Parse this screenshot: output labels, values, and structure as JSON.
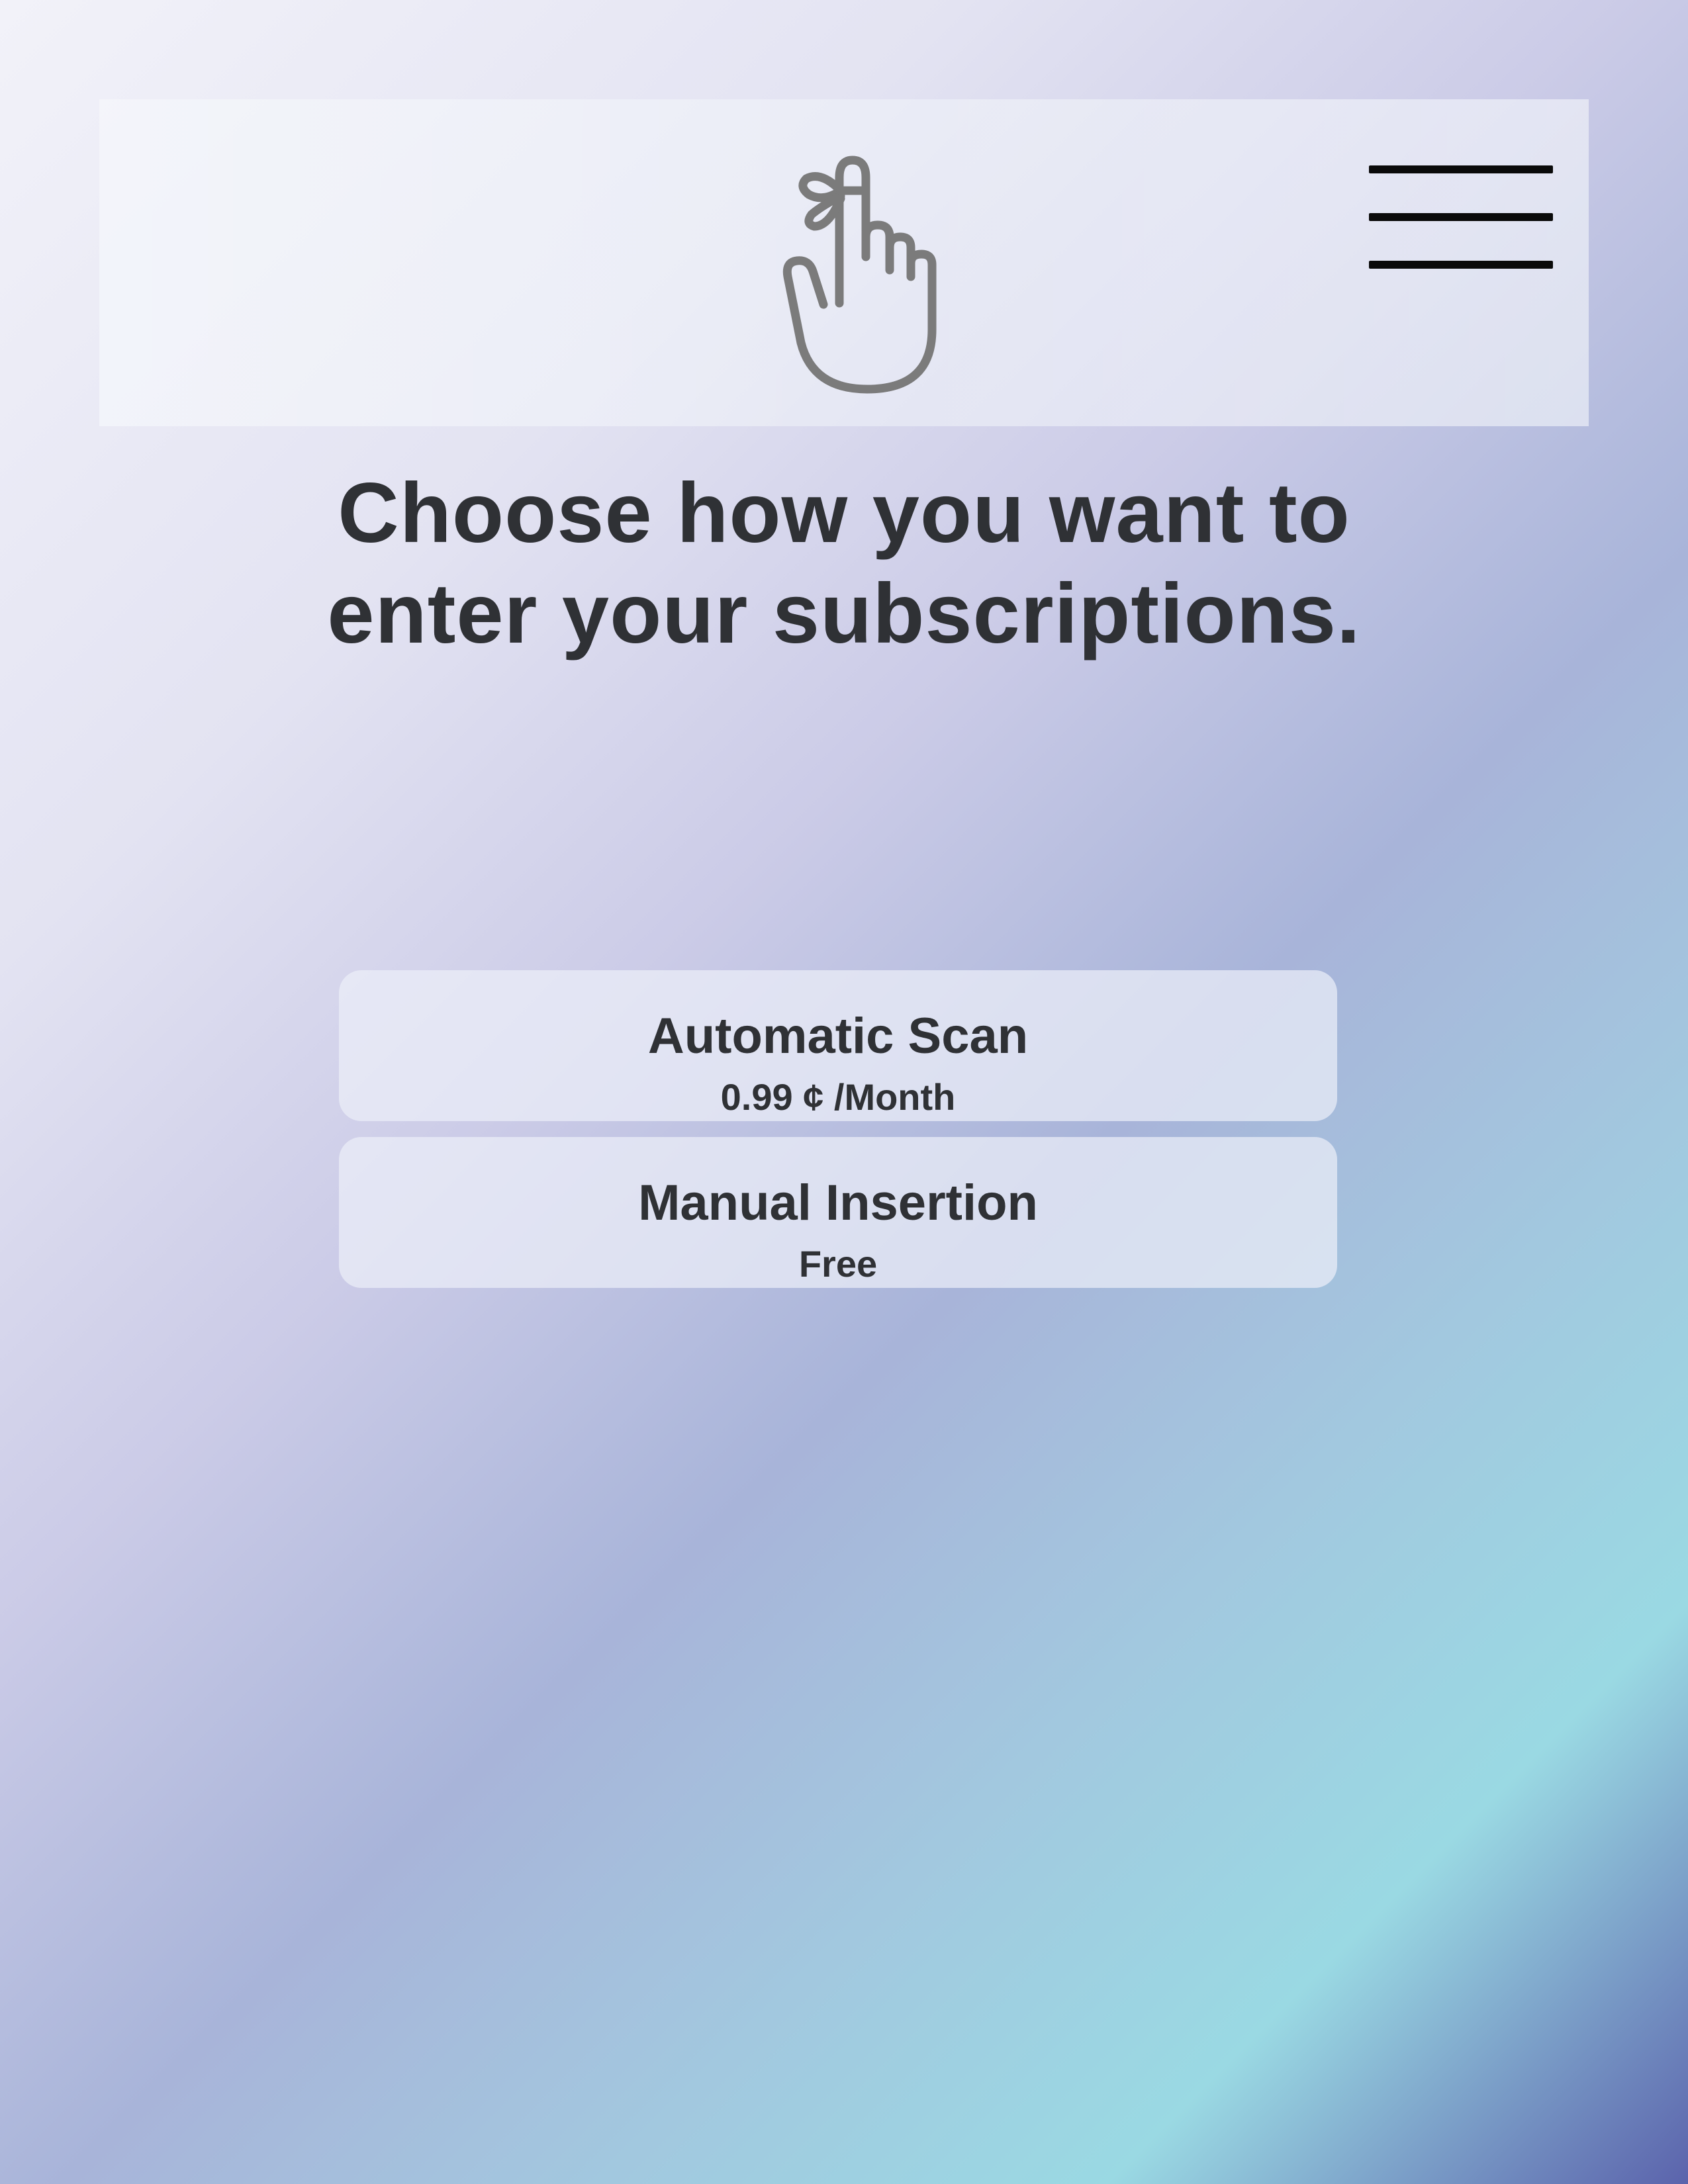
{
  "header": {
    "logo_icon": "finger-reminder-icon",
    "menu_icon": "hamburger-menu-icon"
  },
  "heading": {
    "line1": "Choose how you want to",
    "line2": "enter your subscriptions."
  },
  "options": [
    {
      "title": "Automatic Scan",
      "subtitle": "0.99 ¢ /Month"
    },
    {
      "title": "Manual Insertion",
      "subtitle": "Free"
    }
  ],
  "colors": {
    "text": "#2f3135",
    "icon_gray": "#7b7b7b",
    "menu_black": "#0a0a0a"
  }
}
